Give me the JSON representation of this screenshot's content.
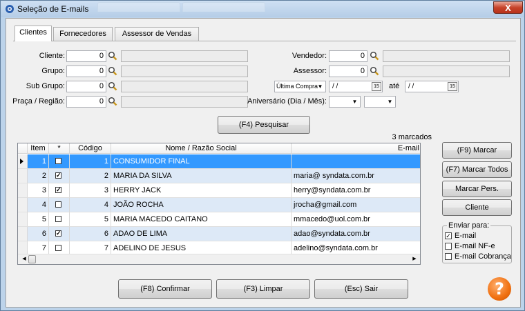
{
  "window": {
    "title": "Seleção de E-mails",
    "close_label": "X"
  },
  "tabs": [
    {
      "label": "Clientes",
      "active": true
    },
    {
      "label": "Fornecedores",
      "active": false
    },
    {
      "label": "Assessor de Vendas",
      "active": false
    }
  ],
  "filters": {
    "cliente_label": "Cliente:",
    "cliente_value": "0",
    "grupo_label": "Grupo:",
    "grupo_value": "0",
    "subgrupo_label": "Sub Grupo:",
    "subgrupo_value": "0",
    "praca_label": "Praça / Região:",
    "praca_value": "0",
    "vendedor_label": "Vendedor:",
    "vendedor_value": "0",
    "assessor_label": "Assessor:",
    "assessor_value": "0",
    "date_type_value": "Última Compra",
    "date_from_value": " /  /",
    "date_cal_label": "15",
    "ate_label": "até",
    "date_to_value": " /  /",
    "aniversario_label": "Aniversário (Dia / Mês):"
  },
  "search_button_label": "(F4) Pesquisar",
  "marked_count_label": "3 marcados",
  "grid": {
    "columns": [
      "Item",
      "*",
      "Código",
      "Nome / Razão Social",
      "E-mail"
    ],
    "rows": [
      {
        "item": "1",
        "checked": false,
        "codigo": "1",
        "nome": "CONSUMIDOR FINAL",
        "email": "",
        "selected": true
      },
      {
        "item": "2",
        "checked": true,
        "codigo": "2",
        "nome": "MARIA DA SILVA",
        "email": "maria@ syndata.com.br"
      },
      {
        "item": "3",
        "checked": true,
        "codigo": "3",
        "nome": "HERRY JACK",
        "email": "herry@syndata.com.br"
      },
      {
        "item": "4",
        "checked": false,
        "codigo": "4",
        "nome": "JOÃO ROCHA",
        "email": "jrocha@gmail.com"
      },
      {
        "item": "5",
        "checked": false,
        "codigo": "5",
        "nome": "MARIA MACEDO CAITANO",
        "email": "mmacedo@uol.com.br"
      },
      {
        "item": "6",
        "checked": true,
        "codigo": "6",
        "nome": "ADAO DE LIMA",
        "email": "adao@syndata.com.br"
      },
      {
        "item": "7",
        "checked": false,
        "codigo": "7",
        "nome": "ADELINO DE JESUS",
        "email": "adelino@syndata.com.br"
      }
    ]
  },
  "side_buttons": {
    "marcar": "(F9) Marcar",
    "marcar_todos": "(F7) Marcar Todos",
    "marcar_pers": "Marcar Pers.",
    "cliente": "Cliente"
  },
  "enviar_para": {
    "legend": "Enviar para:",
    "options": [
      {
        "label": "E-mail",
        "checked": true
      },
      {
        "label": "E-mail NF-e",
        "checked": false
      },
      {
        "label": "E-mail Cobrança",
        "checked": false
      }
    ]
  },
  "bottom_buttons": {
    "confirmar": "(F8) Confirmar",
    "limpar": "(F3) Limpar",
    "sair": "(Esc) Sair"
  },
  "help_label": "?",
  "colors": {
    "selected_row": "#3399ff",
    "alt_row": "#dde9f7",
    "help": "#f07010"
  }
}
